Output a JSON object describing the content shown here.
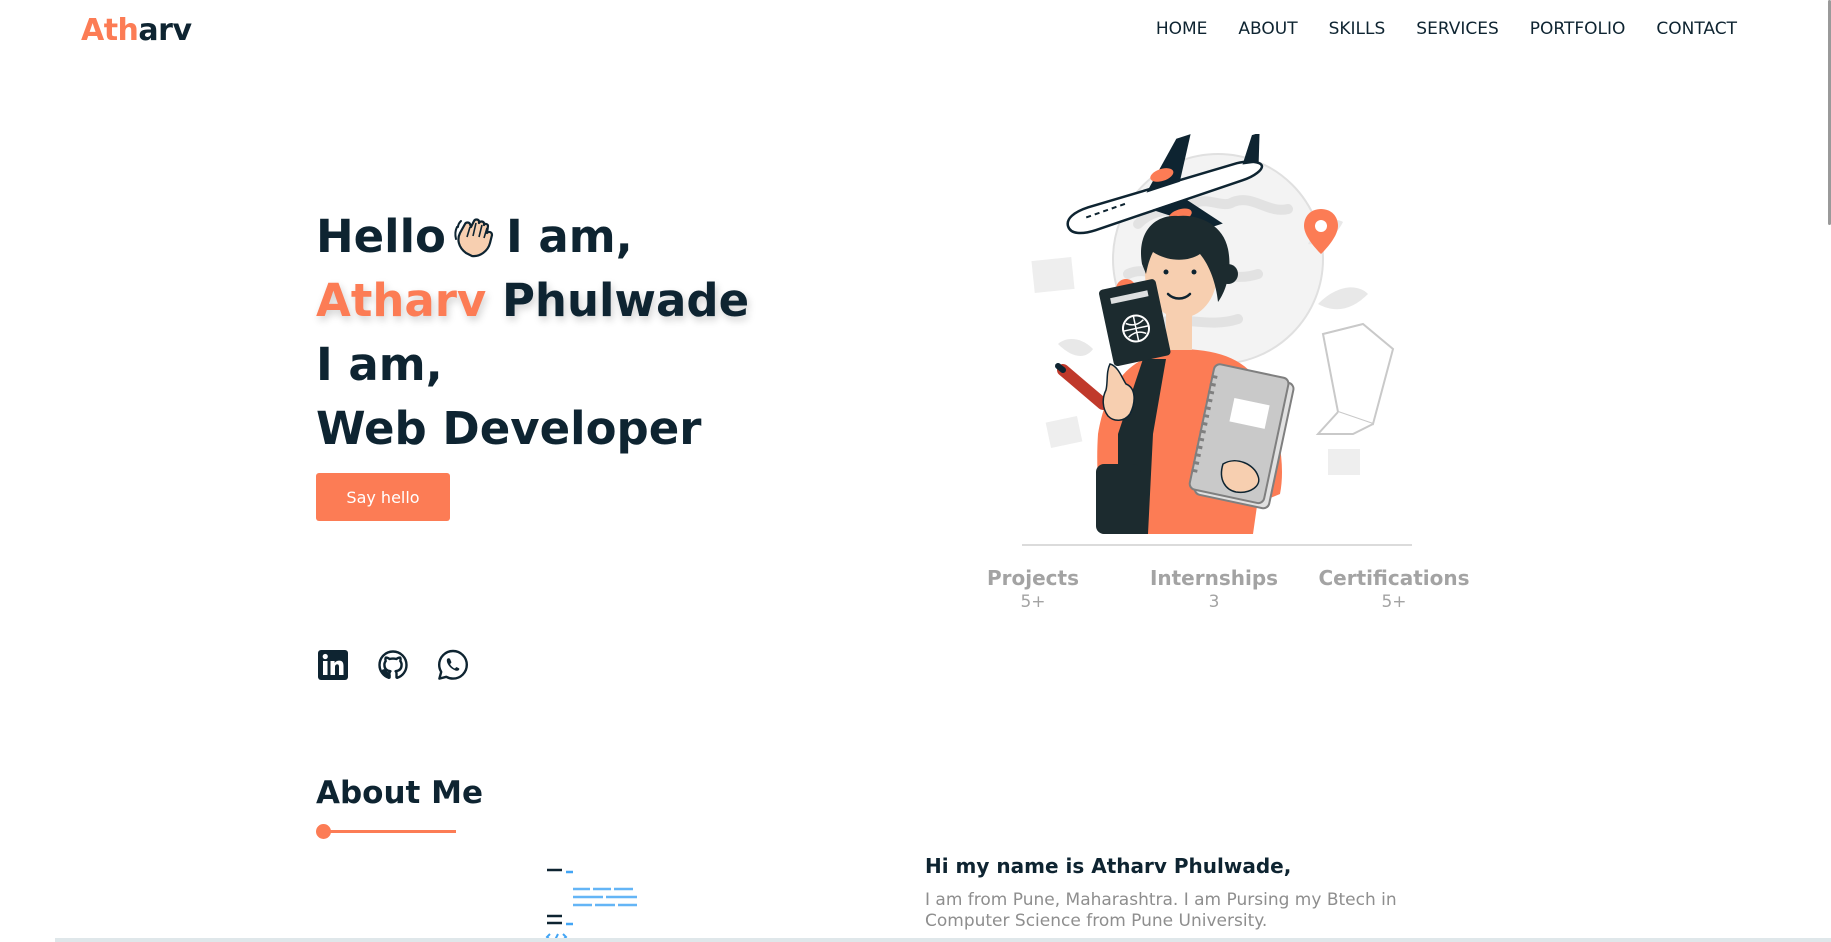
{
  "brand": {
    "part1": "Ath",
    "part2": "arv"
  },
  "nav": {
    "items": [
      "HOME",
      "ABOUT",
      "SKILLS",
      "SERVICES",
      "PORTFOLIO",
      "CONTACT"
    ]
  },
  "hero": {
    "hello": "Hello",
    "wave_icon": "waving-hand-icon",
    "i_am": "I am,",
    "first_name": "Atharv",
    "last_name": "Phulwade",
    "i_am_2": "I am,",
    "role": "Web Developer",
    "button_label": "Say hello"
  },
  "socials": [
    {
      "icon": "linkedin-icon"
    },
    {
      "icon": "github-icon"
    },
    {
      "icon": "whatsapp-icon"
    }
  ],
  "stats": [
    {
      "label": "Projects",
      "value": "5+"
    },
    {
      "label": "Internships",
      "value": "3"
    },
    {
      "label": "Certifications",
      "value": "5+"
    }
  ],
  "about": {
    "title": "About Me",
    "greeting": "Hi my name is Atharv Phulwade,",
    "description": "I am from Pune, Maharashtra. I am Pursing my Btech in Computer Science from Pune University."
  },
  "colors": {
    "accent": "#fc7c55",
    "dark": "#0e2431",
    "muted": "#a3a3a3"
  }
}
